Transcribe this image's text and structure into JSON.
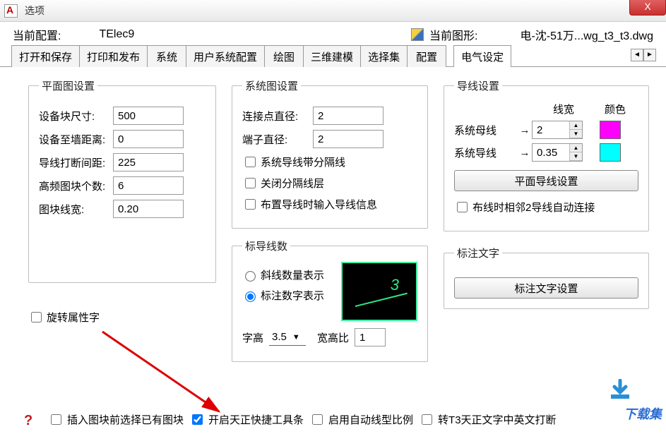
{
  "titlebar": {
    "title": "选项"
  },
  "info": {
    "config_label": "当前配置:",
    "config_value": "TElec9",
    "drawing_label": "当前图形:",
    "drawing_value": "电-沈-51万...wg_t3_t3.dwg"
  },
  "tabs": {
    "items": [
      "打开和保存",
      "打印和发布",
      "系统",
      "用户系统配置",
      "绘图",
      "三维建模",
      "选择集",
      "配置",
      "电气设定"
    ],
    "active": 8
  },
  "plan": {
    "legend": "平面图设置",
    "block_size_label": "设备块尺寸:",
    "block_size": "500",
    "wall_dist_label": "设备至墙距离:",
    "wall_dist": "0",
    "break_gap_label": "导线打断间距:",
    "break_gap": "225",
    "hf_blocks_label": "高频图块个数:",
    "hf_blocks": "6",
    "block_lw_label": "图块线宽:",
    "block_lw": "0.20",
    "rotate_attr_label": "旋转属性字"
  },
  "sys": {
    "legend": "系统图设置",
    "conn_dia_label": "连接点直径:",
    "conn_dia": "2",
    "term_dia_label": "端子直径:",
    "term_dia": "2",
    "chk1": "系统导线带分隔线",
    "chk2": "关闭分隔线层",
    "chk3": "布置导线时输入导线信息"
  },
  "lead": {
    "legend": "标导线数",
    "r1": "斜线数量表示",
    "r2": "标注数字表示",
    "zh_label": "字高",
    "zh": "3.5",
    "kgb_label": "宽高比",
    "kgb": "1",
    "preview_num": "3"
  },
  "wire": {
    "legend": "导线设置",
    "col_width": "线宽",
    "col_color": "颜色",
    "row1_label": "系统母线",
    "row1_val": "2",
    "row1_color": "#ff00ff",
    "row2_label": "系统导线",
    "row2_val": "0.35",
    "row2_color": "#00ffff",
    "btn": "平面导线设置",
    "auto_join": "布线时相邻2导线自动连接"
  },
  "dim": {
    "legend": "标注文字",
    "btn": "标注文字设置"
  },
  "bottom": {
    "c1": "插入图块前选择已有图块",
    "c2": "开启天正快捷工具条",
    "c3": "启用自动线型比例",
    "c4": "转T3天正文字中英文打断"
  },
  "watermark": "下载集"
}
